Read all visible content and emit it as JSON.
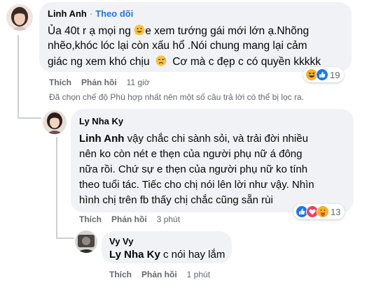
{
  "comments": [
    {
      "author": "Linh Anh",
      "dot": "·",
      "follow_label": "Theo dõi",
      "lines": [
        "Ủa 40t r ạ mọi ng",
        "e xem tướng gái mới lớn ạ.Nhõng",
        "nhẽo,khóc lóc lại còn xấu hổ .Nói chung mang lại cảm",
        "giác ng xem khó chịu",
        "Cơ mà c đẹp c có quyền kkkkk"
      ],
      "like_label": "Thích",
      "reply_label": "Phản hồi",
      "time": "11 giờ",
      "reaction_count": "19",
      "reactions": [
        "haha",
        "like"
      ]
    },
    {
      "author": "Ly Nha Ky",
      "mention": "Linh Anh",
      "lines": [
        "vậy chắc chi sành sỏi, và trải đời nhiều",
        "nên ko còn nét e thẹn của người phụ nữ á đông",
        "nữa rồi. Chứ sự e thẹn của người phụ nữ ko tính",
        "theo tuổi tác. Tiếc cho chị nói lên lời như vậy. Nhìn",
        "hình chị trên fb thấy chị chắc cũng sẵn rùi"
      ],
      "like_label": "Thích",
      "reply_label": "Phản hồi",
      "time": "3 phút",
      "reaction_count": "13",
      "reactions": [
        "like",
        "love",
        "care"
      ]
    },
    {
      "author": "Vy Vy",
      "mention": "Ly Nha Ky",
      "text": "c nói hay lắm",
      "like_label": "Thích",
      "reply_label": "Phản hồi",
      "time": "1 phút"
    }
  ],
  "filter_note": "Đã chọn chế độ Phù hợp nhất nên một số câu trả lời có thể bị lọc ra.",
  "colors": {
    "bubble": "#f0f2f5",
    "link_blue": "#1877f2",
    "meta_gray": "#65676b",
    "thread_line": "#ced0d4",
    "like_blue": "#1877f2",
    "love_red": "#f33e58",
    "haha_yellow": "#f7b125"
  },
  "icons": [
    "smile-emoji-icon",
    "sweat-emoji-icon",
    "haha-reaction-icon",
    "like-reaction-icon",
    "love-reaction-icon",
    "care-reaction-icon"
  ]
}
